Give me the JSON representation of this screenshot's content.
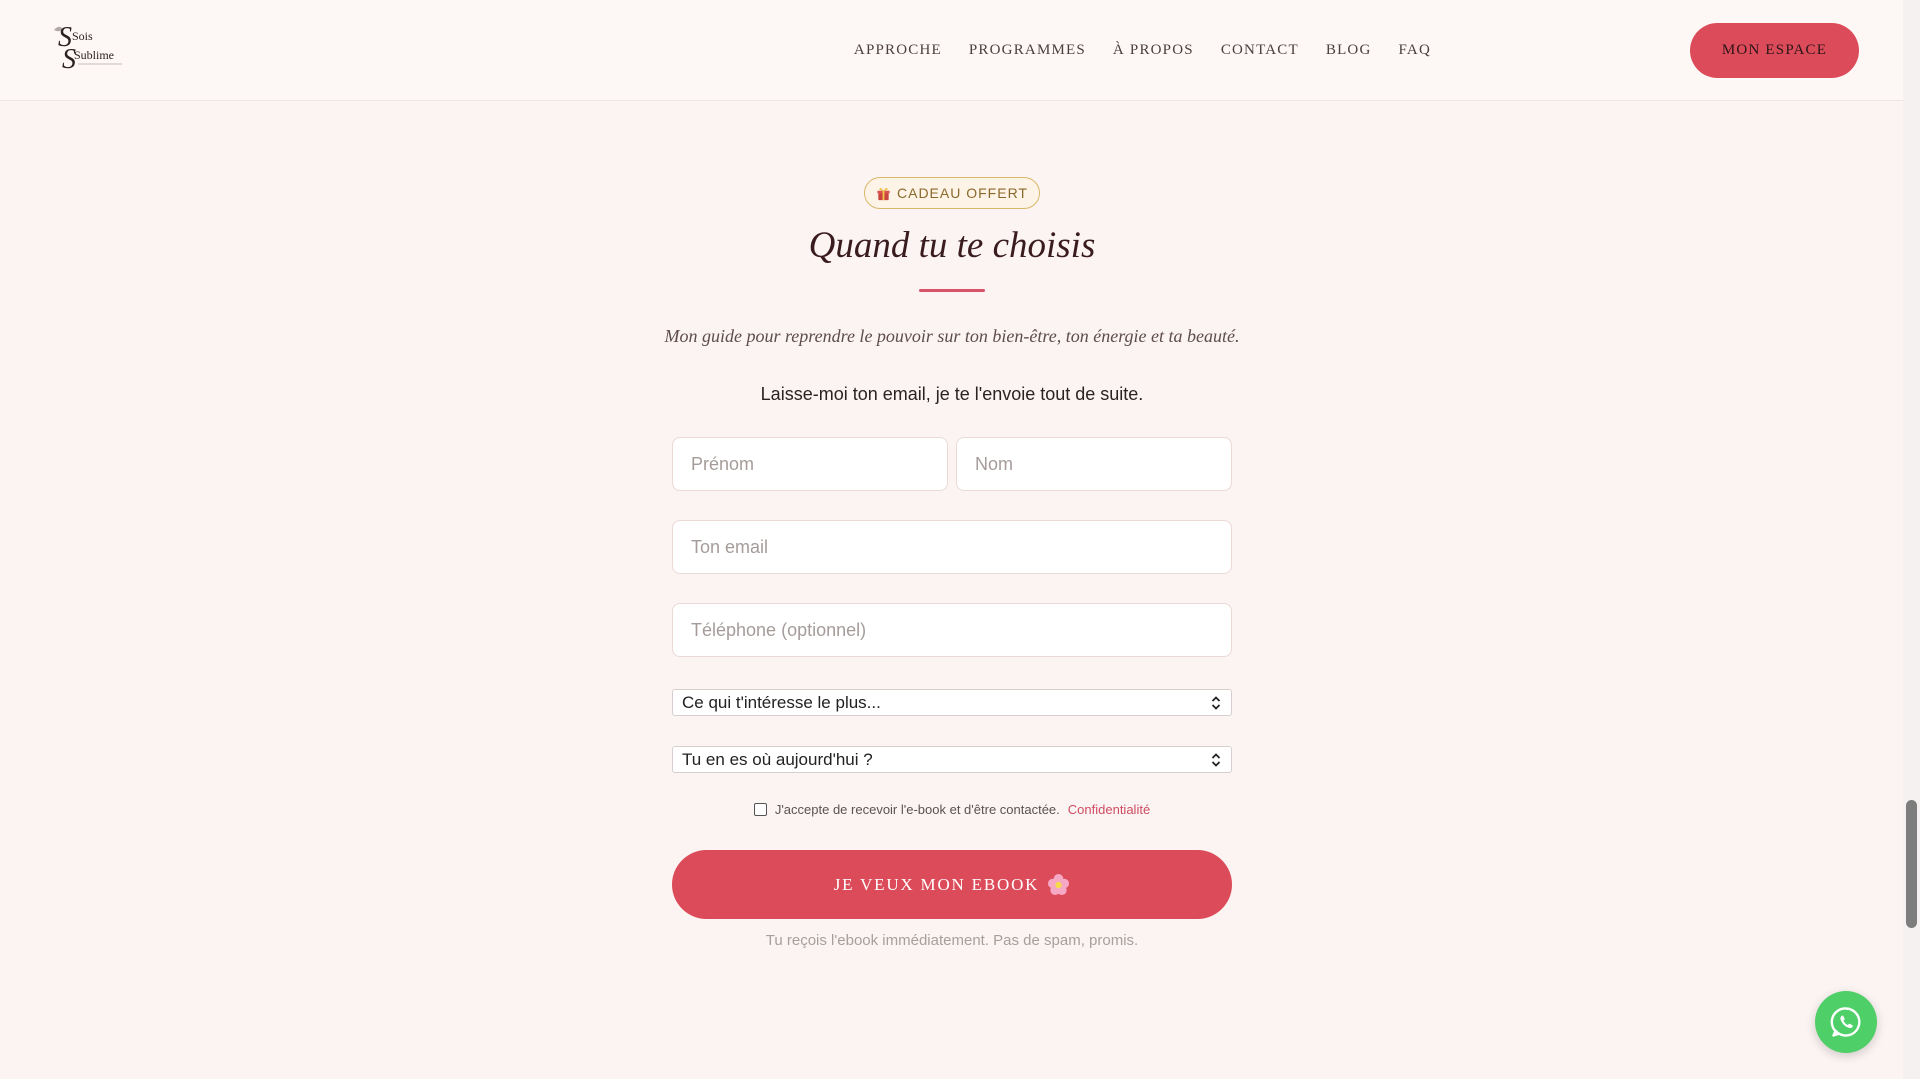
{
  "header": {
    "logo_line1": "Sois",
    "logo_line2": "Sublime",
    "nav": [
      "APPROCHE",
      "PROGRAMMES",
      "À PROPOS",
      "CONTACT",
      "BLOG",
      "FAQ"
    ],
    "cta_label": "MON ESPACE"
  },
  "hero": {
    "badge_label": "CADEAU OFFERT",
    "badge_icon": "gift-icon",
    "title": "Quand tu te choisis",
    "subtitle": "Mon guide pour reprendre le pouvoir sur ton bien-être, ton énergie et ta beauté.",
    "intro": "Laisse-moi ton email, je te l'envoie tout de suite."
  },
  "form": {
    "first_name_placeholder": "Prénom",
    "last_name_placeholder": "Nom",
    "email_placeholder": "Ton email",
    "phone_placeholder": "Téléphone (optionnel)",
    "interest_select": "Ce qui t'intéresse le plus...",
    "stage_select": "Tu en es où aujourd'hui ?",
    "consent_text": "J'accepte de recevoir l'e-book et d'être contactée.",
    "consent_link": "Confidentialité",
    "submit_label": "JE VEUX MON EBOOK",
    "submit_icon": "flower-icon",
    "note": "Tu reçois l'ebook immédiatement. Pas de spam, promis."
  },
  "colors": {
    "accent": "#dc4b59",
    "background": "#fbf4f2",
    "badge_border": "#d9b86a",
    "whatsapp": "#4fcf68"
  }
}
